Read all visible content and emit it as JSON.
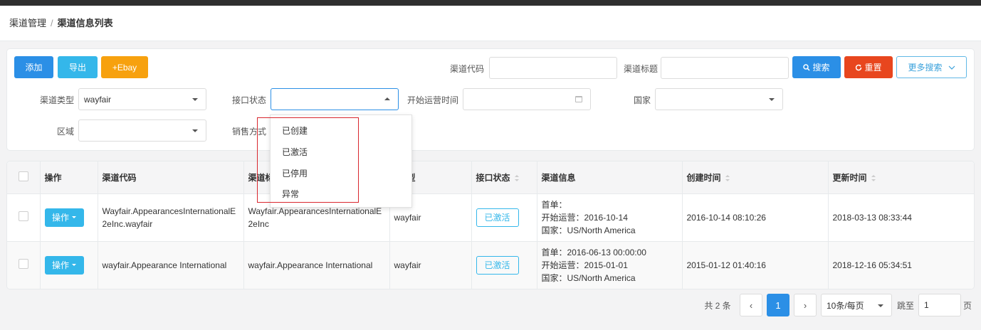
{
  "breadcrumb": {
    "parent": "渠道管理",
    "separator": "/",
    "current": "渠道信息列表"
  },
  "toolbar": {
    "add_label": "添加",
    "export_label": "导出",
    "ebay_label": "+Ebay"
  },
  "search": {
    "channel_code_label": "渠道代码",
    "channel_code_value": "",
    "channel_title_label": "渠道标题",
    "channel_title_value": "",
    "search_label": "搜索",
    "reset_label": "重置",
    "more_label": "更多搜索",
    "channel_type_label": "渠道类型",
    "channel_type_value": "wayfair",
    "api_status_label": "接口状态",
    "api_status_value": "",
    "start_time_label": "开始运营时间",
    "start_time_value": "",
    "country_label": "国家",
    "country_value": "",
    "region_label": "区域",
    "region_value": "",
    "sales_mode_label": "销售方式"
  },
  "status_dropdown": {
    "options": [
      "已创建",
      "已激活",
      "已停用",
      "异常"
    ]
  },
  "table": {
    "columns": [
      "操作",
      "渠道代码",
      "渠道标题",
      "渠道类型",
      "接口状态",
      "渠道信息",
      "创建时间",
      "更新时间"
    ],
    "visible_headers": {
      "op": "操作",
      "code": "渠道代码",
      "title": "渠道标",
      "type": "道类型",
      "status": "接口状态",
      "info": "渠道信息",
      "created": "创建时间",
      "updated": "更新时间"
    },
    "rows": [
      {
        "op_label": "操作",
        "code_line1": "Wayfair.AppearancesInternationalE",
        "code_line2": "2eInc.wayfair",
        "title_line1": "Wayfair.AppearancesInternationalE",
        "title_line2": "2eInc",
        "type": "wayfair",
        "status": "已激活",
        "info_line1": "首单：",
        "info_line2": "开始运营：2016-10-14",
        "info_line3": "国家：US/North America",
        "created": "2016-10-14 08:10:26",
        "updated": "2018-03-13 08:33:44"
      },
      {
        "op_label": "操作",
        "code_line1": "wayfair.Appearance International",
        "code_line2": "",
        "title_line1": "wayfair.Appearance International",
        "title_line2": "",
        "type": "wayfair",
        "status": "已激活",
        "info_line1": "首单：2016-06-13 00:00:00",
        "info_line2": "开始运营：2015-01-01",
        "info_line3": "国家：US/North America",
        "created": "2015-01-12 01:40:16",
        "updated": "2018-12-16 05:34:51"
      }
    ]
  },
  "pagination": {
    "total_label": "共 2 条",
    "prev": "‹",
    "current_page": "1",
    "next": "›",
    "page_size": "10条/每页",
    "jump_label": "跳至",
    "jump_value": "1",
    "page_unit": "页"
  },
  "colors": {
    "primary": "#2b8fe6",
    "info": "#34b7ea",
    "warning": "#f7a10e",
    "danger": "#e8461e",
    "highlight_box": "#d9272e"
  }
}
